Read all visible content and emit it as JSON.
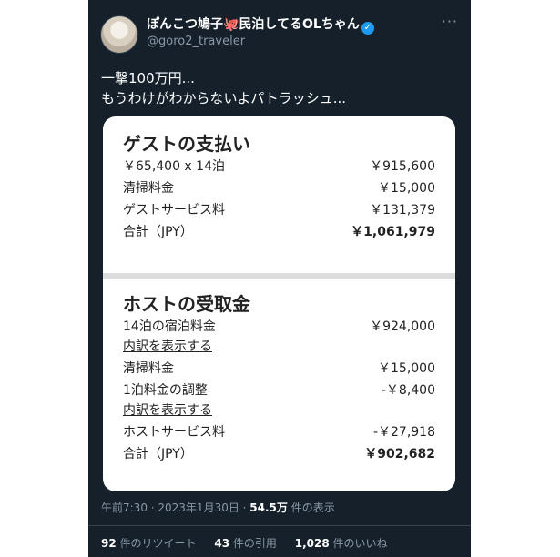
{
  "header": {
    "display_name": "ぽんこつ鳩子🐙民泊してるOLちゃん",
    "verified_mark": "✓",
    "handle": "@goro2_traveler",
    "more_label": "···"
  },
  "tweet": {
    "line1": "一撃100万円...",
    "line2": "もうわけがわからないよパトラッシュ..."
  },
  "guest": {
    "title": "ゲストの支払い",
    "rows": [
      {
        "label": "￥65,400 x 14泊",
        "amount": "￥915,600"
      },
      {
        "label": "清掃料金",
        "amount": "￥15,000"
      },
      {
        "label": "ゲストサービス料",
        "amount": "￥131,379"
      }
    ],
    "total": {
      "label": "合計（JPY）",
      "amount": "￥1,061,979"
    }
  },
  "host": {
    "title": "ホストの受取金",
    "row1": {
      "label": "14泊の宿泊料金",
      "amount": "￥924,000"
    },
    "link1": "内訳を表示する",
    "row2": {
      "label": "清掃料金",
      "amount": "￥15,000"
    },
    "row3": {
      "label": "1泊料金の調整",
      "amount": "-￥8,400"
    },
    "link2": "内訳を表示する",
    "row4": {
      "label": "ホストサービス料",
      "amount": "-￥27,918"
    },
    "total": {
      "label": "合計（JPY）",
      "amount": "￥902,682"
    }
  },
  "meta": {
    "time": "午前7:30 · 2023年1月30日 · ",
    "views_count": "54.5万",
    "views_label": " 件の表示"
  },
  "stats": {
    "retweets_count": "92",
    "retweets_label": " 件のリツイート",
    "quotes_count": "43",
    "quotes_label": " 件の引用",
    "likes_count": "1,028",
    "likes_label": " 件のいいね"
  },
  "colors": {
    "background": "#15202b",
    "verified": "#1d9bf0",
    "muted": "#8b98a5"
  }
}
